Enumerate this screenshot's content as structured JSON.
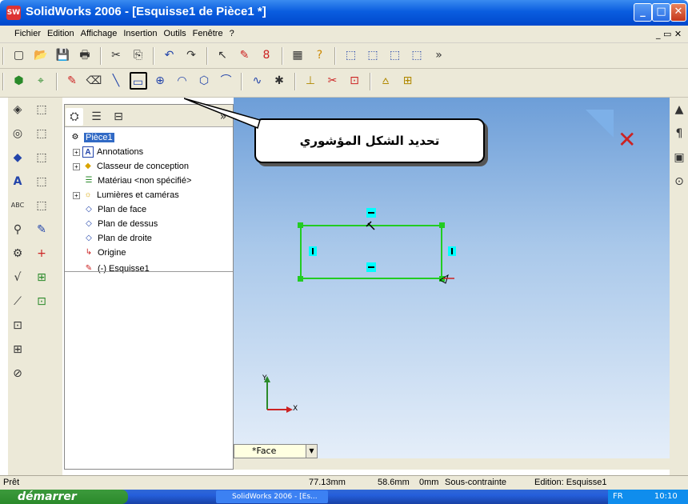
{
  "window": {
    "title": "SolidWorks 2006 - [Esquisse1 de Pièce1 *]",
    "app_icon": "solidworks-logo"
  },
  "menus": [
    "Fichier",
    "Edition",
    "Affichage",
    "Insertion",
    "Outils",
    "Fenêtre",
    "?"
  ],
  "tree": {
    "root": "Pièce1",
    "items": [
      {
        "label": "Annotations",
        "icon": "annotation-icon",
        "expandable": true
      },
      {
        "label": "Classeur de conception",
        "icon": "design-binder-icon",
        "expandable": true
      },
      {
        "label": "Matériau <non spécifié>",
        "icon": "material-icon",
        "expandable": false
      },
      {
        "label": "Lumières et caméras",
        "icon": "lights-icon",
        "expandable": true
      },
      {
        "label": "Plan de face",
        "icon": "plane-icon",
        "expandable": false
      },
      {
        "label": "Plan de dessus",
        "icon": "plane-icon",
        "expandable": false
      },
      {
        "label": "Plan de droite",
        "icon": "plane-icon",
        "expandable": false
      },
      {
        "label": "Origine",
        "icon": "origin-icon",
        "expandable": false
      },
      {
        "label": "(-) Esquisse1",
        "icon": "sketch-icon",
        "expandable": false
      }
    ]
  },
  "callout": {
    "text": "تحديد الشكل المؤشوري"
  },
  "viewport": {
    "view_selector": "*Face",
    "axis_x": "X",
    "axis_y": "Y"
  },
  "status": {
    "ready": "Prêt",
    "x": "77.13mm",
    "y": "58.6mm",
    "z": "0mm",
    "constraint": "Sous-contrainte",
    "edit": "Edition: Esquisse1"
  },
  "taskbar": {
    "start": "démarrer",
    "window": "SolidWorks 2006 - [Es...",
    "lang": "FR",
    "time": "10:10"
  },
  "colors": {
    "sketch_line": "#22cc22",
    "title_bar": "#0a5ddf",
    "tree_selected": "#316ac5"
  }
}
